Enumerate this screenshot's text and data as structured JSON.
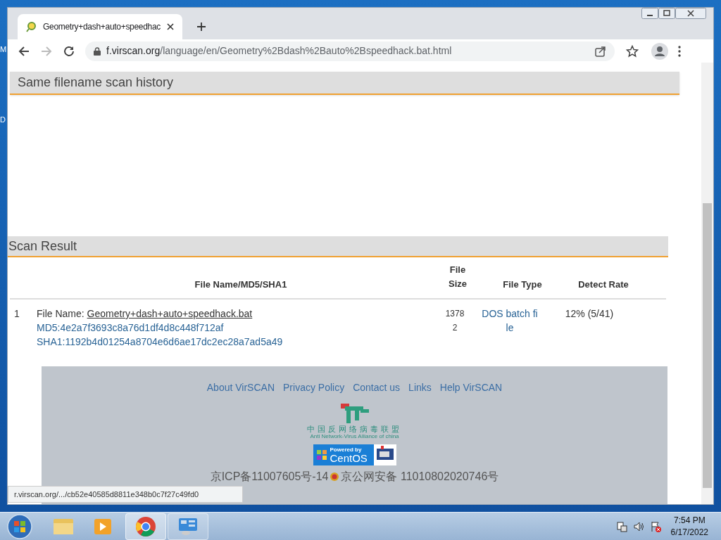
{
  "desktop": {
    "icon_labels": [
      "M",
      "D"
    ]
  },
  "browser": {
    "tabs": [
      {
        "title": "Geometry+dash+auto+speedhac",
        "selected": true
      }
    ],
    "url_host": "f.virscan.org",
    "url_path": "/language/en/Geometry%2Bdash%2Bauto%2Bspeedhack.bat.html",
    "status_url": "r.virscan.org/.../cb52e40585d8811e348b0c7f27c49fd0"
  },
  "history_section": {
    "title": "Same filename scan history"
  },
  "result_section": {
    "title": "Scan Result",
    "columns": [
      "File Name/MD5/SHA1",
      "File Size",
      "File Type",
      "Detect Rate"
    ],
    "rows": [
      {
        "index": "1",
        "file_name_label": "File Name:",
        "file_name": "Geometry+dash+auto+speedhack.bat",
        "md5": "MD5:4e2a7f3693c8a76d1df4d8c448f712af",
        "sha1": "SHA1:1192b4d01254a8704e6d6ae17dc2ec28a7ad5a49",
        "size": "13782",
        "type": "DOS batch file",
        "detect_rate": "12% (5/41)"
      }
    ]
  },
  "footer": {
    "links": [
      "About VirSCAN",
      "Privacy Policy",
      "Contact us",
      "Links",
      "Help VirSCAN"
    ],
    "alliance_cn": "中国反网络病毒联盟",
    "alliance_en": "Anti Network-Virus Alliance of china",
    "centos_top": "Powered by",
    "centos_bottom": "CentOS",
    "icp": "京ICP备11007605号-14",
    "police": "京公网安备 11010802020746号"
  },
  "taskbar": {
    "time": "7:54 PM",
    "date": "6/17/2022"
  }
}
